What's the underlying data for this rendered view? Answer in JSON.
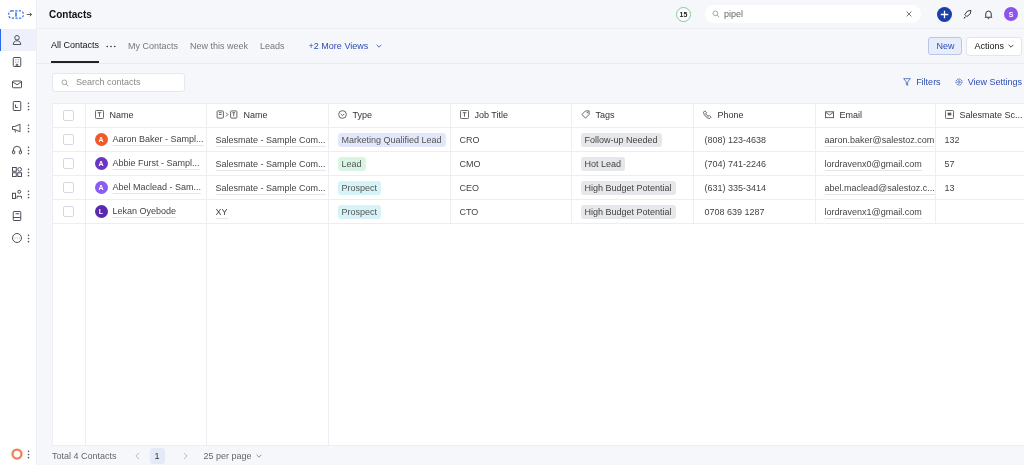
{
  "sidebar": {
    "items": [
      {
        "kind": "person",
        "selected": true,
        "menu": false
      },
      {
        "kind": "building",
        "selected": false,
        "menu": false
      },
      {
        "kind": "mail",
        "selected": false,
        "menu": false
      },
      {
        "kind": "book",
        "selected": false,
        "menu": true
      },
      {
        "kind": "megaphone",
        "selected": false,
        "menu": true
      },
      {
        "kind": "headset",
        "selected": false,
        "menu": true
      },
      {
        "kind": "apps",
        "selected": false,
        "menu": true
      },
      {
        "kind": "org",
        "selected": false,
        "menu": true
      },
      {
        "kind": "notebook",
        "selected": false,
        "menu": false
      },
      {
        "kind": "more",
        "selected": false,
        "menu": true
      }
    ],
    "bottom": {
      "kind": "lifebuoy",
      "menu": true
    }
  },
  "header": {
    "title": "Contacts",
    "badge": "15",
    "search": {
      "value": "pipel"
    },
    "avatar": "S"
  },
  "tabs": [
    {
      "label": "All Contacts",
      "selected": true,
      "kind": "view"
    },
    {
      "label": "My Contacts",
      "selected": false,
      "kind": "view"
    },
    {
      "label": "New this week",
      "selected": false,
      "kind": "view"
    },
    {
      "label": "Leads",
      "selected": false,
      "kind": "view"
    },
    {
      "label": "+2 More Views",
      "selected": false,
      "kind": "more"
    }
  ],
  "actions": {
    "new": "New",
    "menu": "Actions"
  },
  "toolbar": {
    "search": {
      "placeholder": "Search contacts"
    },
    "filters": "Filters",
    "settings": "View Settings"
  },
  "table": {
    "all_checked": false,
    "columns": [
      {
        "label": "Name",
        "kind": "text"
      },
      {
        "label": "Name",
        "kind": "lookup"
      },
      {
        "label": "Type",
        "kind": "select"
      },
      {
        "label": "Job Title",
        "kind": "text"
      },
      {
        "label": "Tags",
        "kind": "tag"
      },
      {
        "label": "Phone",
        "kind": "phone"
      },
      {
        "label": "Email",
        "kind": "email"
      },
      {
        "label": "Salesmate Sc...",
        "kind": "number"
      }
    ],
    "rows": [
      {
        "checked": false,
        "avatar": {
          "initial": "A",
          "color": "#f05a28"
        },
        "name": "Aaron Baker - Sampl...",
        "company": "Salesmate - Sample Com...",
        "type": {
          "label": "Marketing Qualified Lead",
          "color": "#e2e7fb"
        },
        "job": "CRO",
        "tag": "Follow-up Needed",
        "phone": "(808) 123-4638",
        "email": "aaron.baker@salestoz.com",
        "score": "132"
      },
      {
        "checked": false,
        "avatar": {
          "initial": "A",
          "color": "#6b35c2"
        },
        "name": "Abbie Furst - Sampl...",
        "company": "Salesmate - Sample Com...",
        "type": {
          "label": "Lead",
          "color": "#d8f4e4"
        },
        "job": "CMO",
        "tag": "Hot Lead",
        "phone": "(704) 741-2246",
        "email": "lordravenx0@gmail.com",
        "score": "57"
      },
      {
        "checked": false,
        "avatar": {
          "initial": "A",
          "color": "#8a5cf0"
        },
        "name": "Abel Maclead - Sam...",
        "company": "Salesmate - Sample Com...",
        "type": {
          "label": "Prospect",
          "color": "#d6f3f7"
        },
        "job": "CEO",
        "tag": "High Budget Potential",
        "phone": "(631) 335-3414",
        "email": "abel.maclead@salestoz.c...",
        "score": "13"
      },
      {
        "checked": false,
        "avatar": {
          "initial": "L",
          "color": "#5a2aae"
        },
        "name": "Lekan Oyebode",
        "company": "XY",
        "type": {
          "label": "Prospect",
          "color": "#d6f3f7"
        },
        "job": "CTO",
        "tag": "High Budget Potential",
        "phone": "0708 639 1287",
        "email": "lordravenx1@gmail.com",
        "score": ""
      }
    ]
  },
  "footer": {
    "total": "Total 4 Contacts",
    "page": "1",
    "per_page": "25 per page"
  }
}
